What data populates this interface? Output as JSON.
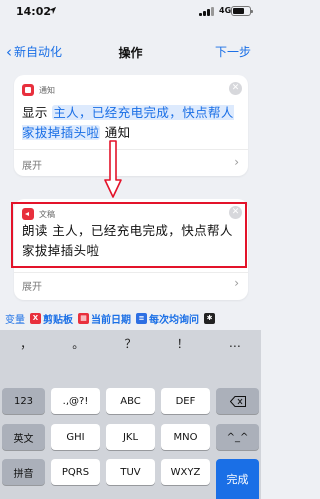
{
  "status_bar": {
    "time": "14:02",
    "network": "4G",
    "battery_level": 0.7
  },
  "nav": {
    "back_label": "新自动化",
    "title": "操作",
    "next_label": "下一步"
  },
  "card1": {
    "app_name": "通知",
    "verb": "显示",
    "token_text": "主人，已经充电完成，快点帮人家拔掉插头啦",
    "suffix": "通知",
    "expand_label": "展开"
  },
  "card2": {
    "app_name": "文稿",
    "verb": "朗读",
    "token_text": "主人，已经充电完成，快点帮人家拔掉插头啦",
    "expand_label": "展开"
  },
  "variables": {
    "label": "变量",
    "chips": [
      {
        "icon": "clipboard-icon",
        "label": "剪贴板"
      },
      {
        "icon": "calendar-icon",
        "label": "当前日期"
      },
      {
        "icon": "dictionary-icon",
        "label": "每次均询问"
      }
    ]
  },
  "keyboard": {
    "punctuation": [
      "，",
      "。",
      "？",
      "！",
      "…"
    ],
    "row1": [
      "123",
      ".,@?!",
      "ABC",
      "DEF"
    ],
    "row2": [
      "英文",
      "GHI",
      "JKL",
      "MNO",
      "^_^"
    ],
    "row3": [
      "拼音",
      "PQRS",
      "TUV",
      "WXYZ"
    ],
    "done_label": "完成"
  },
  "colors": {
    "accent": "#1a6fe6",
    "highlight_red": "#e3132a",
    "app_icon_red": "#e8303d"
  }
}
